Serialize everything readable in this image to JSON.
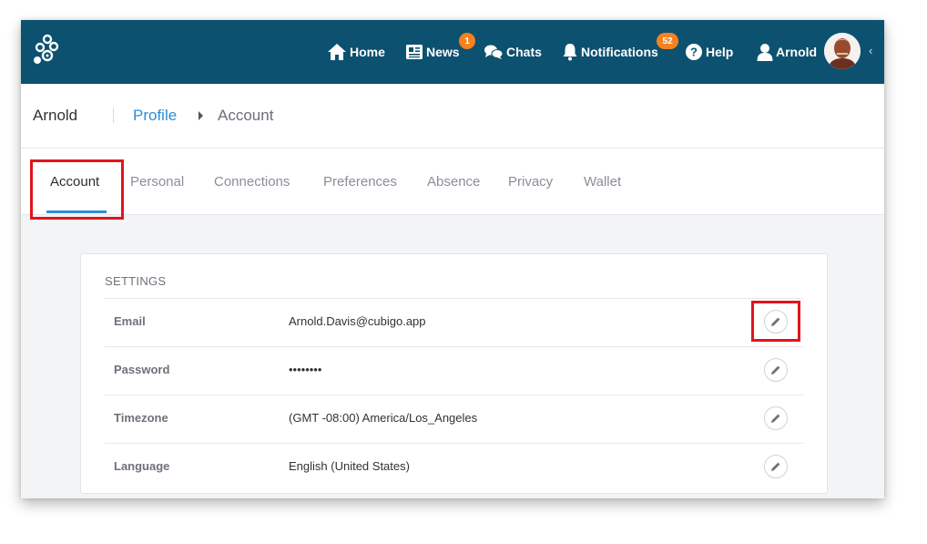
{
  "nav": {
    "home": "Home",
    "news": "News",
    "news_badge": "1",
    "chats": "Chats",
    "notifications": "Notifications",
    "notifications_badge": "52",
    "help": "Help",
    "user": "Arnold",
    "colors": {
      "bar": "#0d5170",
      "badge": "#f5821f"
    }
  },
  "breadcrumb": {
    "user": "Arnold",
    "section": "Profile",
    "current": "Account"
  },
  "tabs": [
    {
      "label": "Account",
      "active": true
    },
    {
      "label": "Personal"
    },
    {
      "label": "Connections"
    },
    {
      "label": "Preferences"
    },
    {
      "label": "Absence"
    },
    {
      "label": "Privacy"
    },
    {
      "label": "Wallet"
    }
  ],
  "settings": {
    "title": "SETTINGS",
    "rows": [
      {
        "label": "Email",
        "value": "Arnold.Davis@cubigo.app"
      },
      {
        "label": "Password",
        "value": "••••••••"
      },
      {
        "label": "Timezone",
        "value": "(GMT -08:00) America/Los_Angeles"
      },
      {
        "label": "Language",
        "value": "English (United States)"
      }
    ]
  },
  "icons": [
    "cubigo-logo-icon",
    "home-icon",
    "news-icon",
    "chats-icon",
    "bell-icon",
    "help-icon",
    "user-icon",
    "pencil-icon"
  ]
}
